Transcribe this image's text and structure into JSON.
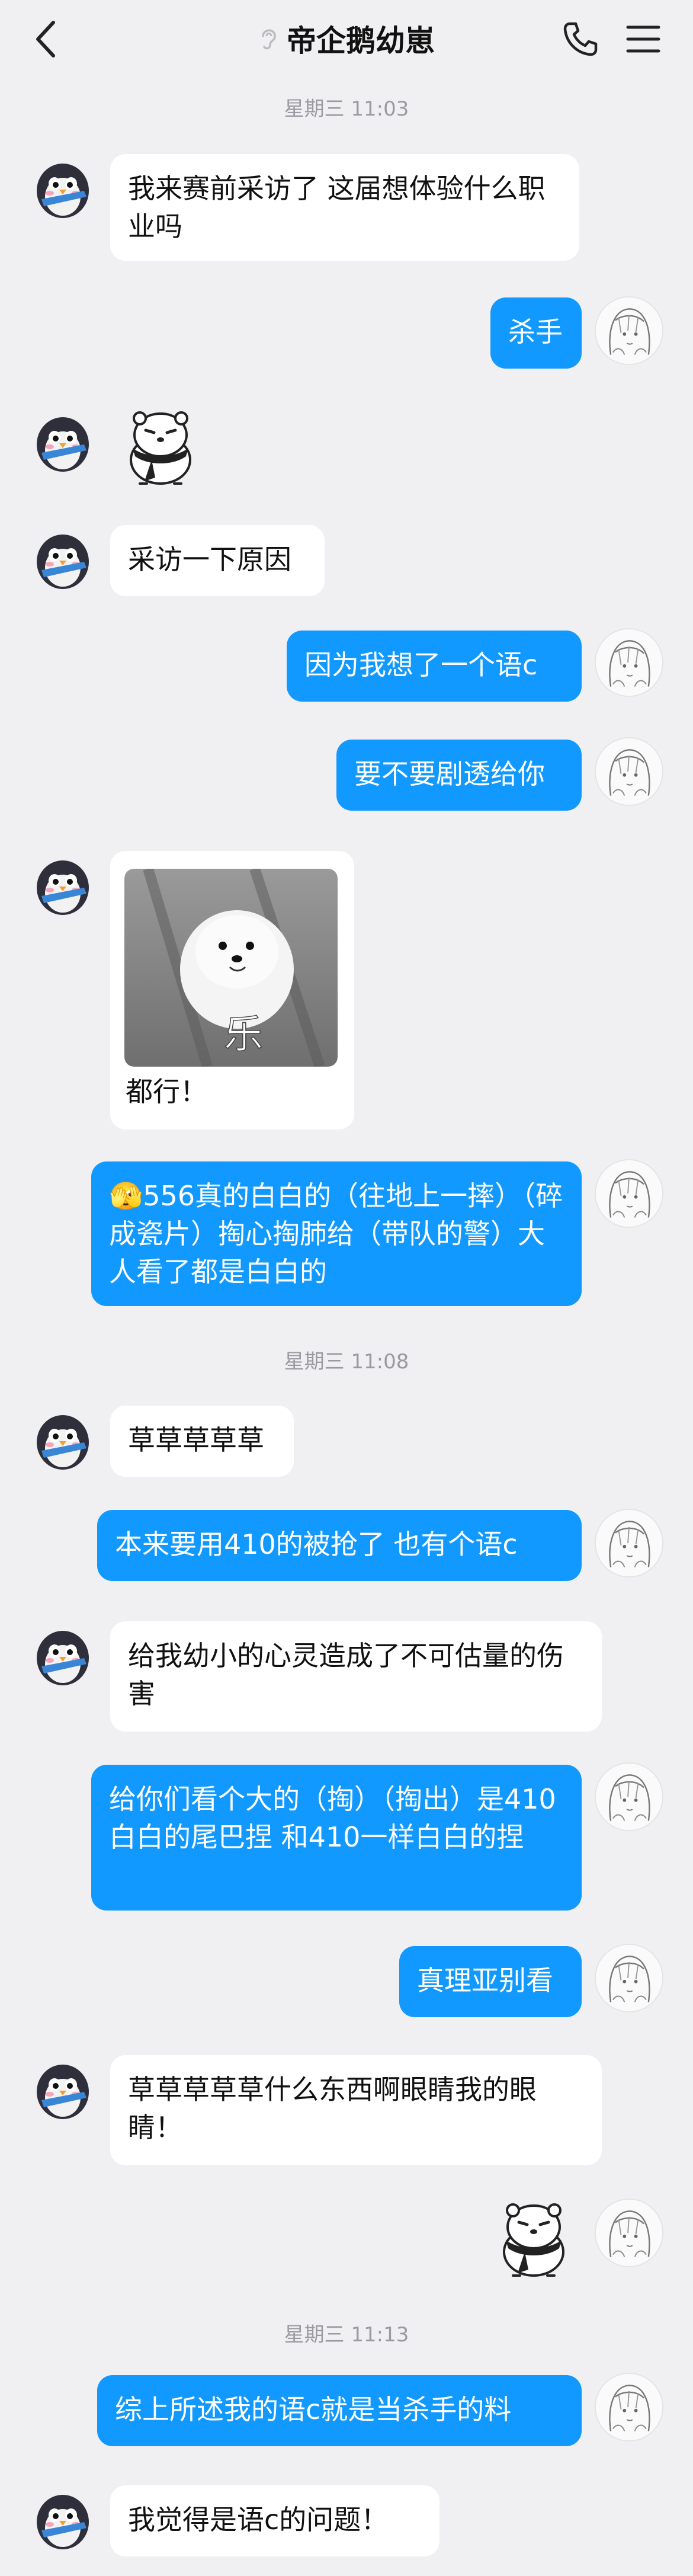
{
  "header": {
    "title": "帝企鹅幼崽"
  },
  "messages": [
    {
      "type": "time",
      "text": "星期三 11:03"
    },
    {
      "type": "in",
      "text": "我来赛前采访了 这届想体验什么职业吗"
    },
    {
      "type": "out",
      "text": "杀手"
    },
    {
      "type": "in-sticker",
      "sticker": "bear-scarf-sticker"
    },
    {
      "type": "in",
      "text": "采访一下原因"
    },
    {
      "type": "out",
      "text": "因为我想了一个语c"
    },
    {
      "type": "out",
      "text": "要不要剧透给你"
    },
    {
      "type": "in-image",
      "image": "white-pomeranian-photo",
      "caption_on_image": "乐",
      "text": "都行！"
    },
    {
      "type": "out",
      "emoji": "🫣",
      "text": "556真的白白的（往地上一摔）（碎成瓷片）掏心掏肺给（带队的警）大人看了都是白白的"
    },
    {
      "type": "time",
      "text": "星期三 11:08"
    },
    {
      "type": "in",
      "text": "草草草草草"
    },
    {
      "type": "out",
      "text": "本来要用410的被抢了 也有个语c"
    },
    {
      "type": "in",
      "text": "给我幼小的心灵造成了不可估量的伤害"
    },
    {
      "type": "out",
      "text": "给你们看个大的（掏）（掏出）是410白白的尾巴捏 和410一样白白的捏"
    },
    {
      "type": "out",
      "text": "真理亚别看"
    },
    {
      "type": "in",
      "text": "草草草草草什么东西啊眼睛我的眼睛！"
    },
    {
      "type": "out-sticker",
      "sticker": "bear-scarf-sticker"
    },
    {
      "type": "time",
      "text": "星期三 11:13"
    },
    {
      "type": "out",
      "text": "综上所述我的语c就是当杀手的料"
    },
    {
      "type": "in",
      "text": "我觉得是语c的问题！"
    }
  ],
  "colors": {
    "background": "#f0f0f2",
    "incoming_bubble": "#ffffff",
    "outgoing_bubble": "#1199ff",
    "timestamp": "#9a9aa0"
  }
}
